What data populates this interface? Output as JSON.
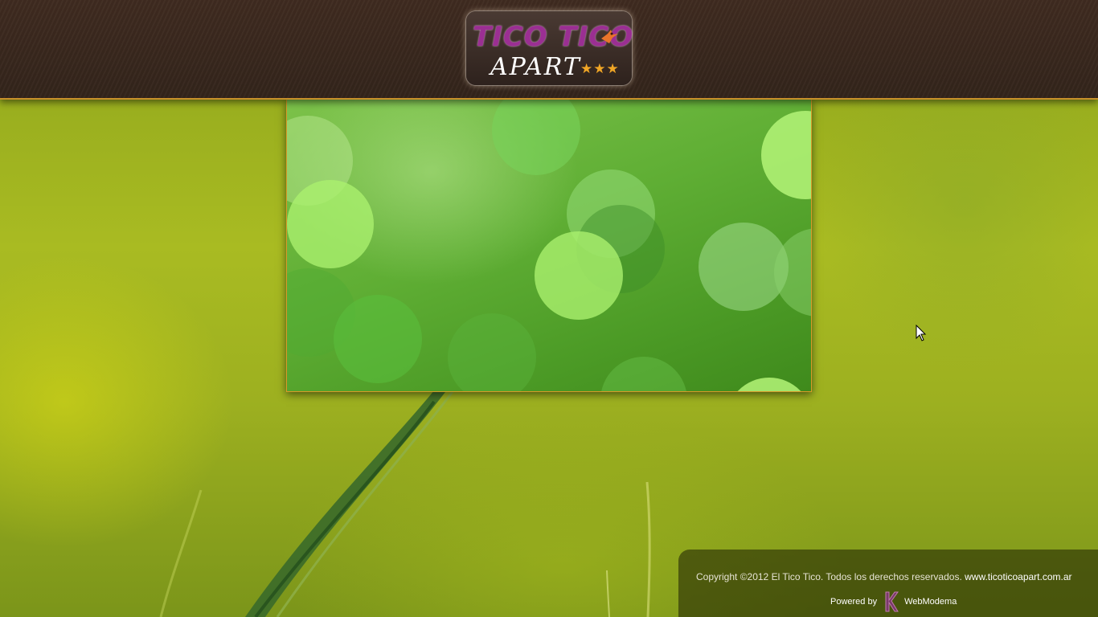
{
  "header": {
    "logo_line1": "TICO TICO",
    "logo_line2": "APART",
    "logo_stars": "★★★"
  },
  "slideshow": {
    "caption": ""
  },
  "footer": {
    "copyright": "Copyright ©2012 El Tico Tico. Todos los derechos reservados.",
    "site_link": "www.ticoticoapart.com.ar",
    "powered_label": "Powered by",
    "powered_brand": "WebModema"
  },
  "colors": {
    "header_brown": "#3f2b20",
    "accent_gold": "#c8902a",
    "logo_purple": "#9b2f93",
    "star_orange": "#f0a626"
  },
  "icons": {
    "logo_bird": "bird-icon",
    "powered_logo": "webmodema-logo-icon",
    "cursor": "mouse-pointer-icon"
  }
}
